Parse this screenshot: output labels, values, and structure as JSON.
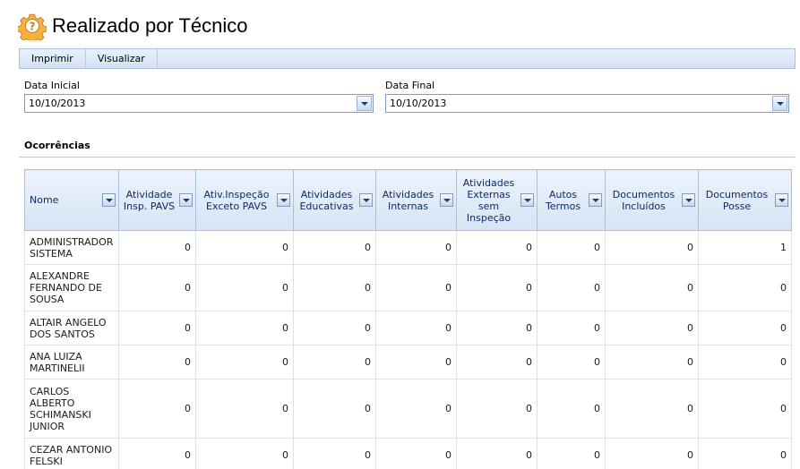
{
  "page": {
    "title": "Realizado por Técnico",
    "icon": "gear-question-icon"
  },
  "toolbar": {
    "print_label": "Imprimir",
    "view_label": "Visualizar"
  },
  "filters": {
    "start": {
      "label": "Data Inicial",
      "value": "10/10/2013"
    },
    "end": {
      "label": "Data Final",
      "value": "10/10/2013"
    }
  },
  "section": {
    "title": "Ocorrências"
  },
  "grid": {
    "columns": [
      "Nome",
      "Atividade Insp. PAVS",
      "Ativ.Inspeção Exceto PAVS",
      "Atividades Educativas",
      "Atividades Internas",
      "Atividades Externas sem Inspeção",
      "Autos Termos",
      "Documentos Incluídos",
      "Documentos Posse"
    ],
    "rows": [
      {
        "name": "ADMINISTRADOR SISTEMA",
        "values": [
          "0",
          "0",
          "0",
          "0",
          "0",
          "0",
          "0",
          "1"
        ]
      },
      {
        "name": "ALEXANDRE FERNANDO DE SOUSA",
        "values": [
          "0",
          "0",
          "0",
          "0",
          "0",
          "0",
          "0",
          "0"
        ]
      },
      {
        "name": "ALTAIR ANGELO DOS SANTOS",
        "values": [
          "0",
          "0",
          "0",
          "0",
          "0",
          "0",
          "0",
          "0"
        ]
      },
      {
        "name": "ANA LUIZA MARTINELII",
        "values": [
          "0",
          "0",
          "0",
          "0",
          "0",
          "0",
          "0",
          "0"
        ]
      },
      {
        "name": "CARLOS ALBERTO SCHIMANSKI JUNIOR",
        "values": [
          "0",
          "0",
          "0",
          "0",
          "0",
          "0",
          "0",
          "0"
        ]
      },
      {
        "name": "CEZAR ANTONIO FELSKI",
        "values": [
          "0",
          "0",
          "0",
          "0",
          "0",
          "0",
          "0",
          "0"
        ]
      }
    ]
  },
  "colors": {
    "header_text": "#0b2a66",
    "toolbar_border": "#a9c1df",
    "icon_orange": "#f0a030"
  }
}
